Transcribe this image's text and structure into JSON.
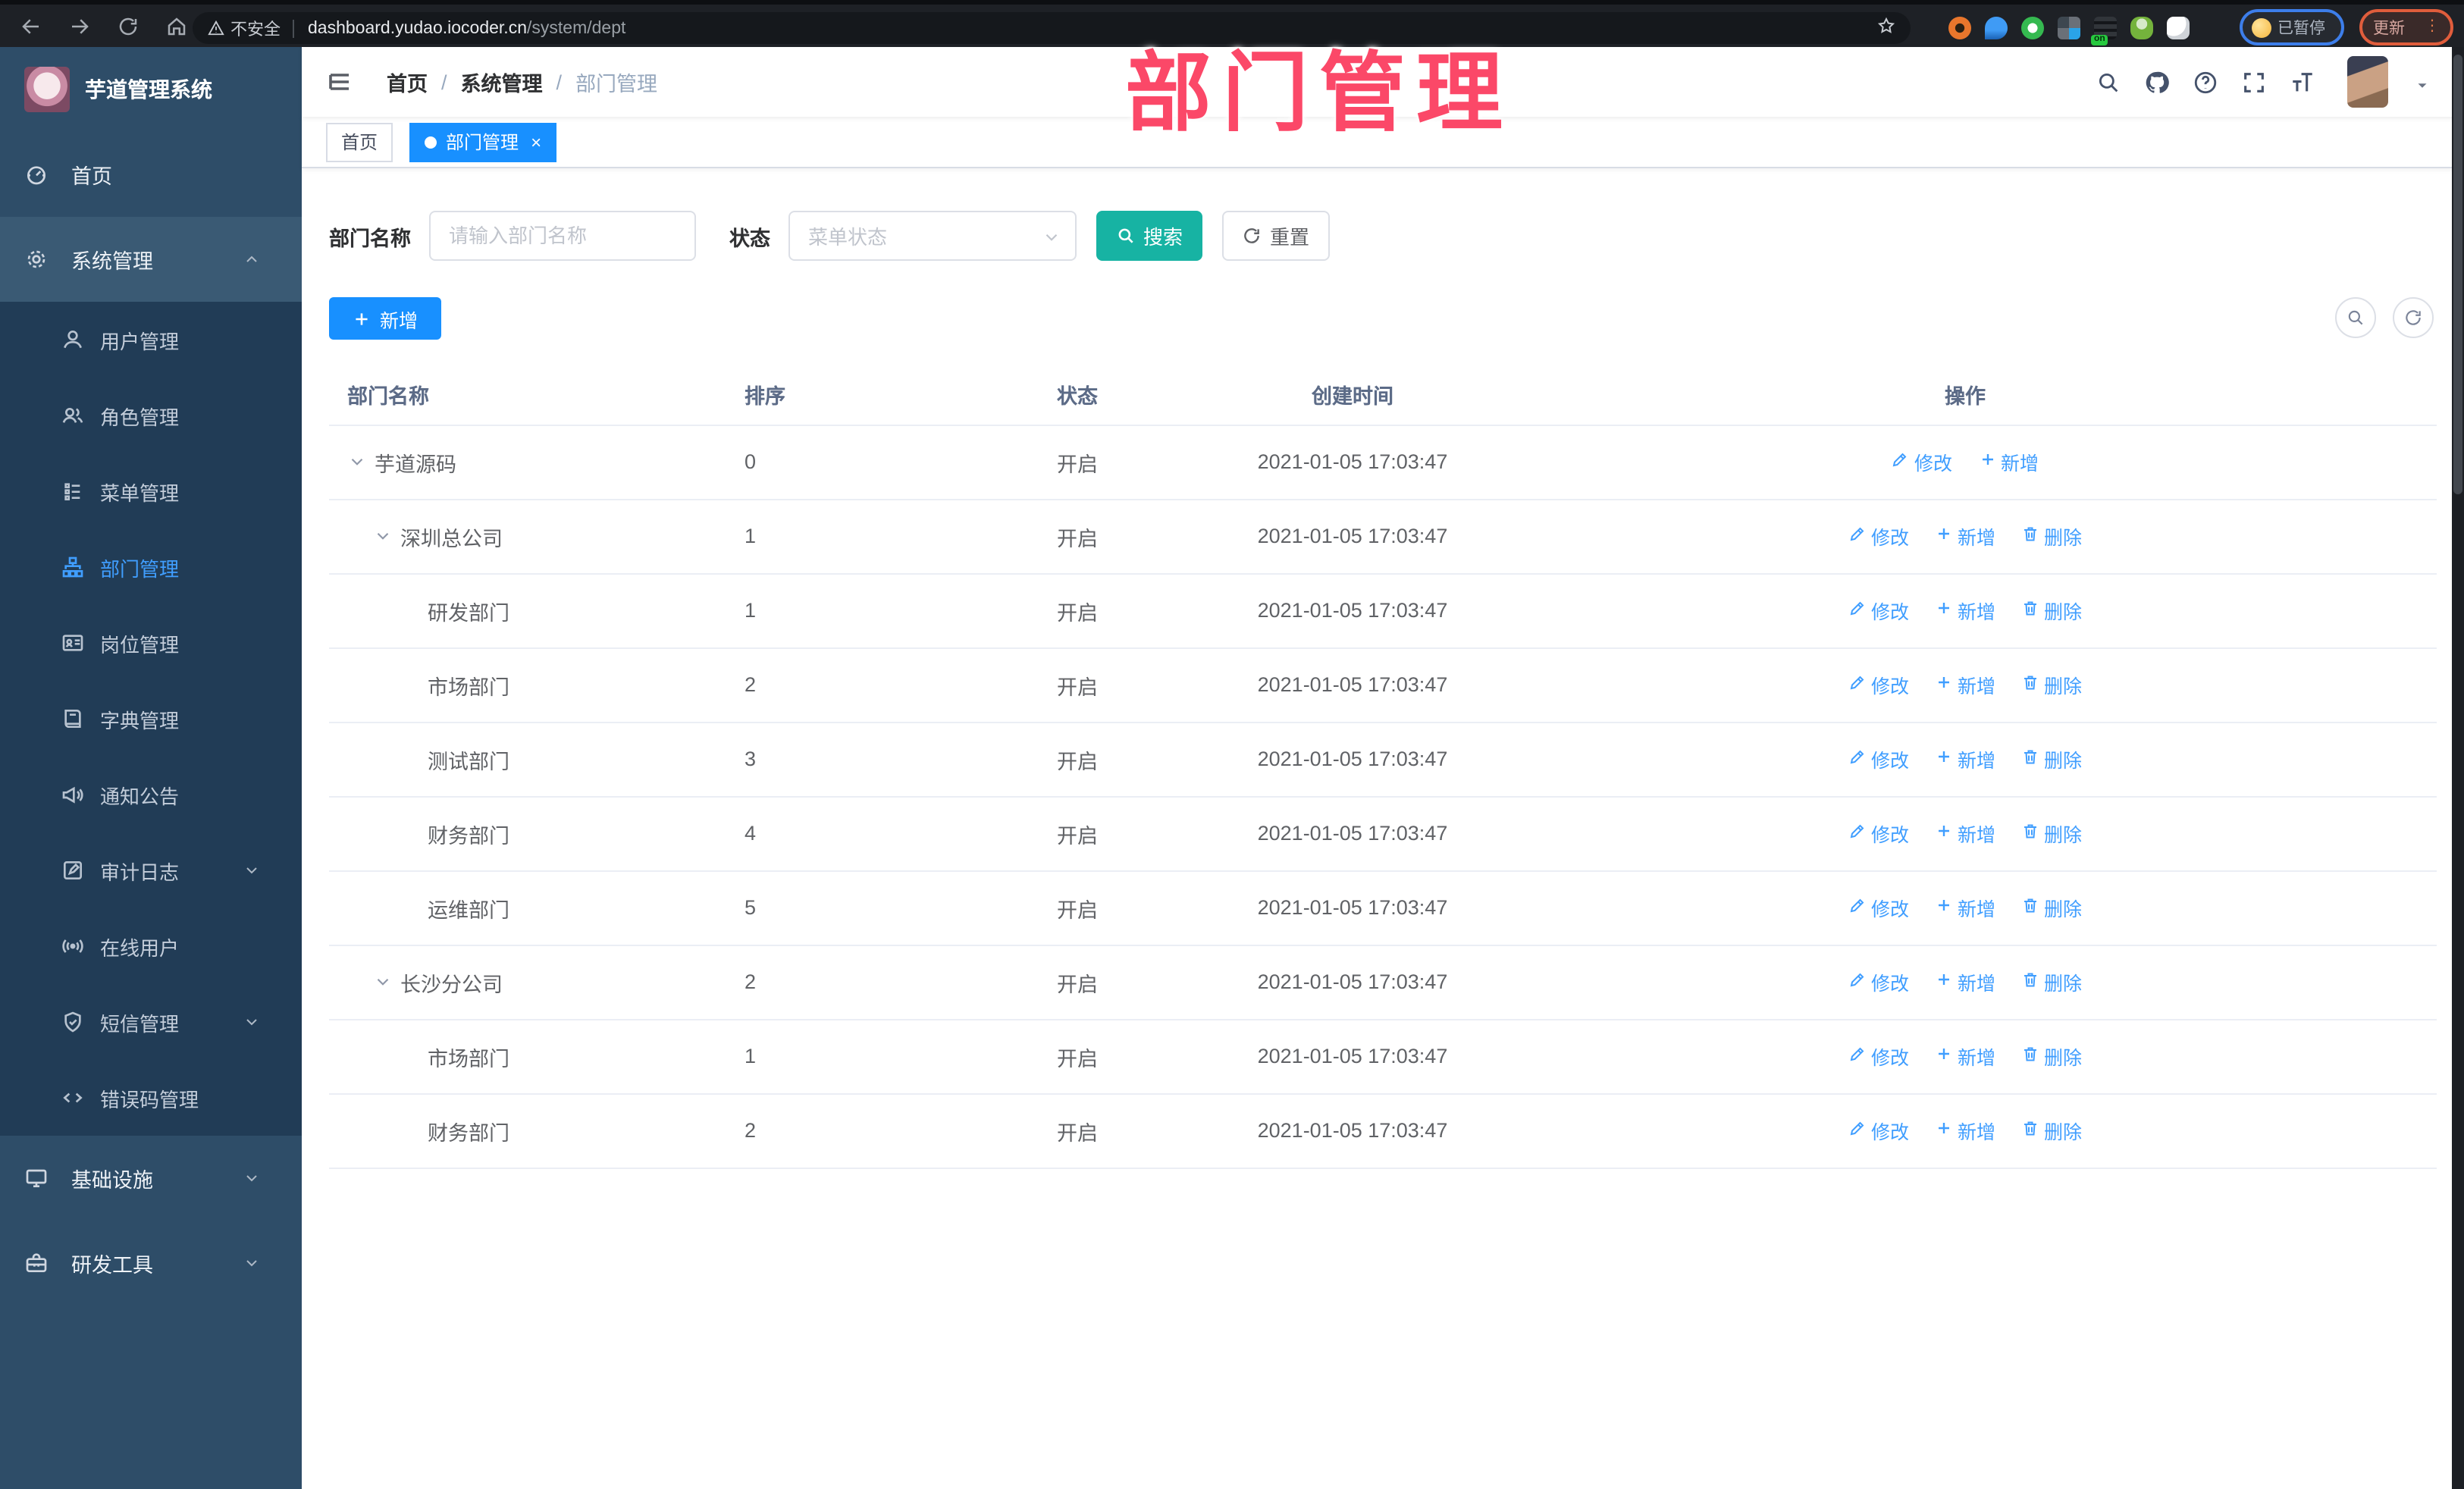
{
  "colors": {
    "blue": "#1890ff",
    "link": "#409eff",
    "teal": "#17b3a3",
    "pink": "#fb4868",
    "sidebar": "#2e4d68",
    "submenu": "#213c56",
    "sidebar_open": "#3a5a74"
  },
  "browser": {
    "security_warning": "不安全",
    "url_host": "dashboard.yudao.iocoder.cn",
    "url_path": "/system/dept",
    "extension_badge": "on",
    "paused_badge": "已暂停",
    "update_button": "更新",
    "extensions": [
      "extension-orange-icon",
      "extension-pin-icon",
      "extension-green-check-icon",
      "extension-grid-icon",
      "extension-list-on-icon",
      "extension-person-icon",
      "extension-puzzle-icon"
    ]
  },
  "overlay_title": "部门管理",
  "sidebar": {
    "app_title": "芋道管理系统",
    "items": [
      {
        "label": "首页",
        "icon": "dashboard-icon",
        "level": 0
      },
      {
        "label": "系统管理",
        "icon": "gear-icon",
        "level": 0,
        "open": true,
        "arrow": "up"
      },
      {
        "label": "用户管理",
        "icon": "user-icon",
        "level": 1
      },
      {
        "label": "角色管理",
        "icon": "users-icon",
        "level": 1
      },
      {
        "label": "菜单管理",
        "icon": "menu-list-icon",
        "level": 1
      },
      {
        "label": "部门管理",
        "icon": "org-tree-icon",
        "level": 1,
        "active": true
      },
      {
        "label": "岗位管理",
        "icon": "id-card-icon",
        "level": 1
      },
      {
        "label": "字典管理",
        "icon": "book-icon",
        "level": 1
      },
      {
        "label": "通知公告",
        "icon": "megaphone-icon",
        "level": 1
      },
      {
        "label": "审计日志",
        "icon": "edit-square-icon",
        "level": 1,
        "arrow": "down"
      },
      {
        "label": "在线用户",
        "icon": "online-icon",
        "level": 1
      },
      {
        "label": "短信管理",
        "icon": "shield-check-icon",
        "level": 1,
        "arrow": "down"
      },
      {
        "label": "错误码管理",
        "icon": "code-icon",
        "level": 1
      },
      {
        "label": "基础设施",
        "icon": "monitor-icon",
        "level": 0,
        "arrow": "down"
      },
      {
        "label": "研发工具",
        "icon": "toolbox-icon",
        "level": 0,
        "arrow": "down"
      }
    ]
  },
  "header": {
    "breadcrumb": [
      "首页",
      "系统管理",
      "部门管理"
    ]
  },
  "tags": [
    {
      "label": "首页",
      "active": false
    },
    {
      "label": "部门管理",
      "active": true
    }
  ],
  "filters": {
    "name_label": "部门名称",
    "name_placeholder": "请输入部门名称",
    "status_label": "状态",
    "status_placeholder": "菜单状态",
    "search_label": "搜索",
    "reset_label": "重置"
  },
  "toolbar": {
    "add_label": "新增"
  },
  "table": {
    "columns": [
      "部门名称",
      "排序",
      "状态",
      "创建时间",
      "操作"
    ],
    "rows": [
      {
        "name": "芋道源码",
        "level": 0,
        "expand": true,
        "sort": "0",
        "status": "开启",
        "created": "2021-01-05 17:03:47",
        "actions": [
          {
            "label": "修改",
            "icon": "edit-icon"
          },
          {
            "label": "新增",
            "icon": "plus-icon"
          }
        ]
      },
      {
        "name": "深圳总公司",
        "level": 1,
        "expand": true,
        "sort": "1",
        "status": "开启",
        "created": "2021-01-05 17:03:47",
        "actions": [
          {
            "label": "修改",
            "icon": "edit-icon"
          },
          {
            "label": "新增",
            "icon": "plus-icon"
          },
          {
            "label": "删除",
            "icon": "trash-icon"
          }
        ]
      },
      {
        "name": "研发部门",
        "level": 2,
        "expand": false,
        "sort": "1",
        "status": "开启",
        "created": "2021-01-05 17:03:47",
        "actions": [
          {
            "label": "修改",
            "icon": "edit-icon"
          },
          {
            "label": "新增",
            "icon": "plus-icon"
          },
          {
            "label": "删除",
            "icon": "trash-icon"
          }
        ]
      },
      {
        "name": "市场部门",
        "level": 2,
        "expand": false,
        "sort": "2",
        "status": "开启",
        "created": "2021-01-05 17:03:47",
        "actions": [
          {
            "label": "修改",
            "icon": "edit-icon"
          },
          {
            "label": "新增",
            "icon": "plus-icon"
          },
          {
            "label": "删除",
            "icon": "trash-icon"
          }
        ]
      },
      {
        "name": "测试部门",
        "level": 2,
        "expand": false,
        "sort": "3",
        "status": "开启",
        "created": "2021-01-05 17:03:47",
        "actions": [
          {
            "label": "修改",
            "icon": "edit-icon"
          },
          {
            "label": "新增",
            "icon": "plus-icon"
          },
          {
            "label": "删除",
            "icon": "trash-icon"
          }
        ]
      },
      {
        "name": "财务部门",
        "level": 2,
        "expand": false,
        "sort": "4",
        "status": "开启",
        "created": "2021-01-05 17:03:47",
        "actions": [
          {
            "label": "修改",
            "icon": "edit-icon"
          },
          {
            "label": "新增",
            "icon": "plus-icon"
          },
          {
            "label": "删除",
            "icon": "trash-icon"
          }
        ]
      },
      {
        "name": "运维部门",
        "level": 2,
        "expand": false,
        "sort": "5",
        "status": "开启",
        "created": "2021-01-05 17:03:47",
        "actions": [
          {
            "label": "修改",
            "icon": "edit-icon"
          },
          {
            "label": "新增",
            "icon": "plus-icon"
          },
          {
            "label": "删除",
            "icon": "trash-icon"
          }
        ]
      },
      {
        "name": "长沙分公司",
        "level": 1,
        "expand": true,
        "sort": "2",
        "status": "开启",
        "created": "2021-01-05 17:03:47",
        "actions": [
          {
            "label": "修改",
            "icon": "edit-icon"
          },
          {
            "label": "新增",
            "icon": "plus-icon"
          },
          {
            "label": "删除",
            "icon": "trash-icon"
          }
        ]
      },
      {
        "name": "市场部门",
        "level": 2,
        "expand": false,
        "sort": "1",
        "status": "开启",
        "created": "2021-01-05 17:03:47",
        "actions": [
          {
            "label": "修改",
            "icon": "edit-icon"
          },
          {
            "label": "新增",
            "icon": "plus-icon"
          },
          {
            "label": "删除",
            "icon": "trash-icon"
          }
        ]
      },
      {
        "name": "财务部门",
        "level": 2,
        "expand": false,
        "sort": "2",
        "status": "开启",
        "created": "2021-01-05 17:03:47",
        "actions": [
          {
            "label": "修改",
            "icon": "edit-icon"
          },
          {
            "label": "新增",
            "icon": "plus-icon"
          },
          {
            "label": "删除",
            "icon": "trash-icon"
          }
        ]
      }
    ]
  }
}
